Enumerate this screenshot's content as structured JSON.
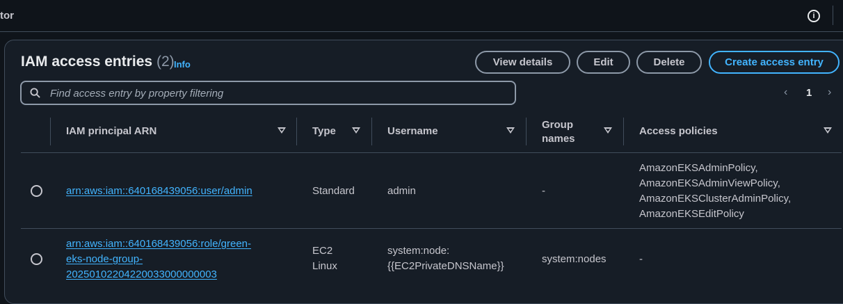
{
  "topbar": {
    "crumb": "tor",
    "info_icon": "i"
  },
  "header": {
    "title": "IAM access entries",
    "count": "(2)",
    "info": "Info",
    "buttons": {
      "view_details": "View details",
      "edit": "Edit",
      "delete": "Delete",
      "create": "Create access entry"
    }
  },
  "search": {
    "placeholder": "Find access entry by property filtering"
  },
  "pagination": {
    "page": "1",
    "prev": "‹",
    "next": "›"
  },
  "columns": {
    "arn": "IAM principal ARN",
    "type": "Type",
    "username": "Username",
    "group_line1": "Group",
    "group_line2": "names",
    "policies": "Access policies"
  },
  "rows": [
    {
      "arn": "arn:aws:iam::640168439056:user/admin",
      "type": "Standard",
      "username": "admin",
      "groups": "-",
      "policies": [
        "AmazonEKSAdminPolicy,",
        "AmazonEKSAdminViewPolicy,",
        "AmazonEKSClusterAdminPolicy,",
        "AmazonEKSEditPolicy"
      ]
    },
    {
      "arn_lines": [
        "arn:aws:iam::640168439056:role/green-",
        "eks-node-group-",
        "20250102204220033000000003"
      ],
      "type_lines": [
        "EC2",
        "Linux"
      ],
      "username_lines": [
        "system:node:",
        "{{EC2PrivateDNSName}}"
      ],
      "groups": "system:nodes",
      "policies": "-"
    }
  ],
  "colors": {
    "background": "#0f141a",
    "panel": "#161d26",
    "accent": "#42b4ff",
    "border": "#414d5c"
  }
}
